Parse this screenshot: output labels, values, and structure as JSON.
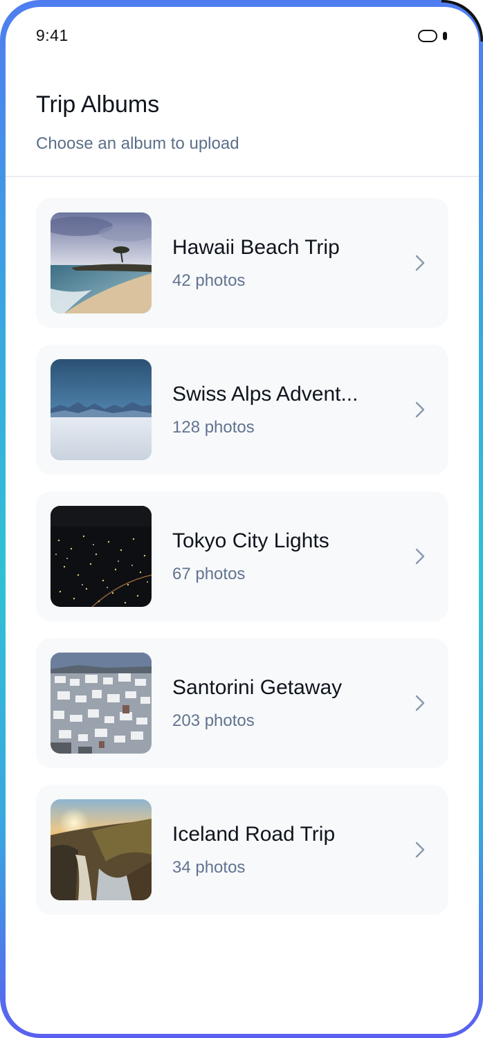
{
  "status_bar": {
    "time": "9:41"
  },
  "header": {
    "title": "Trip Albums",
    "subtitle": "Choose an album to upload"
  },
  "albums": [
    {
      "name": "Hawaii Beach Trip",
      "count": "42 photos",
      "thumbnail": "beach-photo"
    },
    {
      "name": "Swiss Alps Advent...",
      "count": "128 photos",
      "thumbnail": "mountains-photo"
    },
    {
      "name": "Tokyo City Lights",
      "count": "67 photos",
      "thumbnail": "city-night-photo"
    },
    {
      "name": "Santorini Getaway",
      "count": "203 photos",
      "thumbnail": "village-photo"
    },
    {
      "name": "Iceland Road Trip",
      "count": "34 photos",
      "thumbnail": "waterfall-sunset-photo"
    }
  ],
  "icons": {
    "chevron": "chevron-right-icon",
    "camera": "camera-cutout-icon"
  },
  "colors": {
    "title": "#0f141c",
    "subtitle": "#5b6e8a",
    "card_background": "#f7f9fb",
    "chevron": "#8a98ad",
    "divider": "#e9edf3"
  }
}
